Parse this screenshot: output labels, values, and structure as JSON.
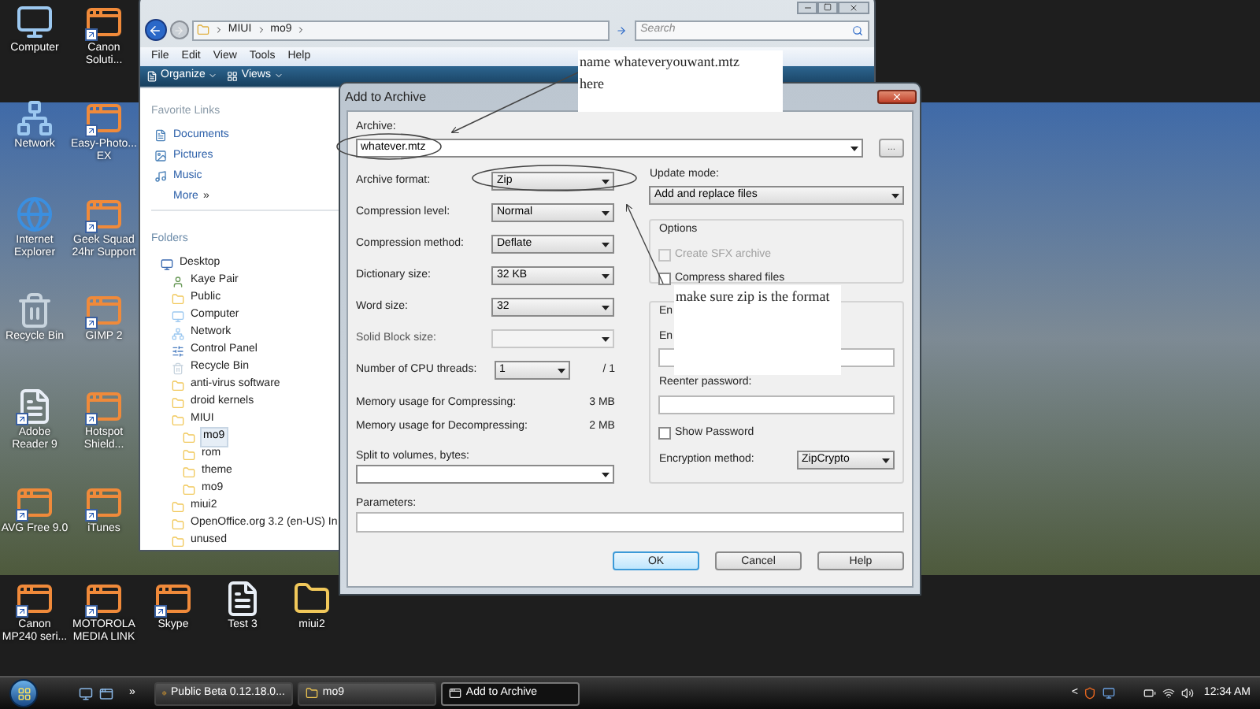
{
  "desktop_icons": [
    {
      "label": "Computer",
      "kind": "computer",
      "shortcut": false
    },
    {
      "label": "Canon Soluti...",
      "kind": "app",
      "shortcut": true
    },
    {
      "label": "Network",
      "kind": "network",
      "shortcut": false
    },
    {
      "label": "Easy-Photo... EX",
      "kind": "app",
      "shortcut": true
    },
    {
      "label": "Internet Explorer",
      "kind": "browser",
      "shortcut": false
    },
    {
      "label": "Geek Squad 24hr Support",
      "kind": "app",
      "shortcut": true
    },
    {
      "label": "Recycle Bin",
      "kind": "trash",
      "shortcut": false
    },
    {
      "label": "GIMP 2",
      "kind": "app",
      "shortcut": true
    },
    {
      "label": "Adobe Reader 9",
      "kind": "document",
      "shortcut": true
    },
    {
      "label": "Hotspot Shield...",
      "kind": "app",
      "shortcut": true
    },
    {
      "label": "AVG Free 9.0",
      "kind": "app",
      "shortcut": true
    },
    {
      "label": "iTunes",
      "kind": "app",
      "shortcut": true
    }
  ],
  "desktop_bottom_icons": [
    {
      "label": "Canon MP240 seri...",
      "kind": "app",
      "shortcut": true
    },
    {
      "label": "MOTOROLA MEDIA LINK",
      "kind": "app",
      "shortcut": true
    },
    {
      "label": "Skype",
      "kind": "app",
      "shortcut": true
    },
    {
      "label": "Test 3",
      "kind": "document",
      "shortcut": false
    },
    {
      "label": "miui2",
      "kind": "folder",
      "shortcut": false
    }
  ],
  "explorer": {
    "path": [
      "MIUI",
      "mo9"
    ],
    "search_placeholder": "Search",
    "menu": [
      "File",
      "Edit",
      "View",
      "Tools",
      "Help"
    ],
    "toolbar": [
      "Organize",
      "Views"
    ],
    "favorites_title": "Favorite Links",
    "favorites": [
      {
        "label": "Documents"
      },
      {
        "label": "Pictures"
      },
      {
        "label": "Music"
      }
    ],
    "more": "More",
    "more_mark": "»",
    "folders_title": "Folders",
    "tree": [
      {
        "label": "Desktop",
        "kind": "desktop",
        "selected": false,
        "children": [
          {
            "label": "Kaye Pair",
            "kind": "user",
            "selected": false
          },
          {
            "label": "Public",
            "kind": "folder",
            "selected": false
          },
          {
            "label": "Computer",
            "kind": "computer",
            "selected": false
          },
          {
            "label": "Network",
            "kind": "network",
            "selected": false
          },
          {
            "label": "Control Panel",
            "kind": "control",
            "selected": false
          },
          {
            "label": "Recycle Bin",
            "kind": "trash",
            "selected": false
          },
          {
            "label": "anti-virus software",
            "kind": "folder",
            "selected": false
          },
          {
            "label": "droid kernels",
            "kind": "folder",
            "selected": false
          },
          {
            "label": "MIUI",
            "kind": "folder",
            "selected": false,
            "children": [
              {
                "label": "mo9",
                "kind": "folder",
                "selected": true
              },
              {
                "label": "rom",
                "kind": "folder",
                "selected": false
              },
              {
                "label": "theme",
                "kind": "folder",
                "selected": false
              },
              {
                "label": "mo9",
                "kind": "folder",
                "selected": false
              }
            ]
          },
          {
            "label": "miui2",
            "kind": "folder",
            "selected": false
          },
          {
            "label": "OpenOffice.org 3.2 (en-US) In",
            "kind": "folder",
            "selected": false
          },
          {
            "label": "unused",
            "kind": "folder",
            "selected": false
          }
        ]
      }
    ]
  },
  "dialog": {
    "title": "Add to Archive",
    "archive_label": "Archive:",
    "archive_value": "whatever.mtz",
    "browse": "...",
    "left_rows": [
      {
        "kind": "select",
        "label": "Archive format:",
        "value": "Zip",
        "disabled": false
      },
      {
        "kind": "select",
        "label": "Compression level:",
        "value": "Normal",
        "disabled": false
      },
      {
        "kind": "select",
        "label": "Compression method:",
        "value": "Deflate",
        "disabled": false
      },
      {
        "kind": "select",
        "label": "Dictionary size:",
        "value": "32 KB",
        "disabled": false
      },
      {
        "kind": "select",
        "label": "Word size:",
        "value": "32",
        "disabled": false
      },
      {
        "kind": "select",
        "label": "Solid Block size:",
        "disabled": true
      },
      {
        "kind": "threads",
        "label": "Number of CPU threads:",
        "value": "1",
        "suffix": "/ 1",
        "disabled": false
      },
      {
        "kind": "readout",
        "label": "Memory usage for Compressing:",
        "value": "3 MB"
      },
      {
        "kind": "readout",
        "label": "Memory usage for Decompressing:",
        "value": "2 MB"
      }
    ],
    "split_label": "Split to volumes, bytes:",
    "parameters_label": "Parameters:",
    "update_label": "Update mode:",
    "update_value": "Add and replace files",
    "options_title": "Options",
    "options": [
      {
        "label": "Create SFX archive",
        "checked": false,
        "disabled": true
      },
      {
        "label": "Compress shared files",
        "checked": false,
        "disabled": false
      }
    ],
    "encryption_title": "En",
    "password_label": "En",
    "reenter_label": "Reenter password:",
    "show_password": {
      "label": "Show Password",
      "checked": false
    },
    "encryption_method_label": "Encryption method:",
    "encryption_method": "ZipCrypto",
    "buttons": [
      {
        "label": "OK",
        "default": true
      },
      {
        "label": "Cancel",
        "default": false
      },
      {
        "label": "Help",
        "default": false
      }
    ]
  },
  "notes": [
    {
      "lines": [
        "name whateveryouwant.mtz",
        "here"
      ]
    },
    {
      "lines": [
        "make sure zip is the format"
      ]
    }
  ],
  "taskbar": {
    "overflow": "»",
    "items": [
      {
        "label": "Public Beta 0.12.18.0...",
        "selected": false
      },
      {
        "label": "mo9",
        "selected": false
      },
      {
        "label": "Add to Archive",
        "selected": true
      }
    ],
    "tray_expand": "<",
    "clock": "12:34 AM"
  }
}
